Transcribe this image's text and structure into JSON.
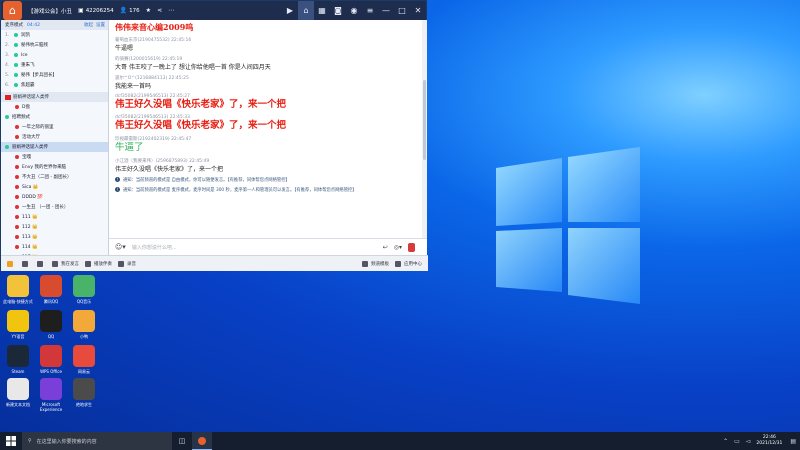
{
  "window": {
    "title": "【游戏公会】小丑",
    "id_count": "42206254",
    "user_count": "176",
    "star": "★"
  },
  "left_panel": {
    "mode_label": "麦序模式",
    "mode_time": "04:42",
    "mode_actions": [
      "收起",
      "设置"
    ],
    "queue": [
      {
        "num": "1.",
        "name": "润凯"
      },
      {
        "num": "2.",
        "name": "秘伟杭三脑残"
      },
      {
        "num": "3.",
        "name": "Ice"
      },
      {
        "num": "4.",
        "name": "重朱飞"
      },
      {
        "num": "5.",
        "name": "秘伟【步兵团长】"
      },
      {
        "num": "6.",
        "name": "焦超霸"
      }
    ],
    "channel_header": "丽娟神话诞人类传",
    "items": [
      {
        "label": "D盘",
        "indent": 1,
        "selected": false
      },
      {
        "label": "招聘频式",
        "indent": 0,
        "selected": false
      },
      {
        "label": "一年之际的丽里",
        "indent": 1,
        "selected": false
      },
      {
        "label": "活动大厅",
        "indent": 1,
        "selected": false
      },
      {
        "label": "丽娟神话诞人类传",
        "indent": 0,
        "selected": true
      },
      {
        "label": "宝嘎",
        "indent": 1,
        "selected": false
      },
      {
        "label": "Envy 我的世界你来脑",
        "indent": 1,
        "selected": false
      },
      {
        "label": "不大丑（二团 - 副团长）",
        "indent": 1,
        "selected": false
      },
      {
        "label": "Sica 👑",
        "indent": 1,
        "selected": false
      },
      {
        "label": "DDDD 💯",
        "indent": 1,
        "selected": false
      },
      {
        "label": "一生丑 （一团 - 团长）",
        "indent": 1,
        "selected": false
      },
      {
        "label": "111 👑",
        "indent": 1,
        "selected": false
      },
      {
        "label": "112 👑",
        "indent": 1,
        "selected": false
      },
      {
        "label": "113 👑",
        "indent": 1,
        "selected": false
      },
      {
        "label": "114 👑",
        "indent": 1,
        "selected": false
      },
      {
        "label": "117 👑",
        "indent": 1,
        "selected": false
      }
    ]
  },
  "chat": {
    "messages": [
      {
        "meta": "",
        "body": "伟伟来音心编2009呜",
        "style": "serifred"
      },
      {
        "meta": "葡萄血东京(2190475532)  22:45:16",
        "body": "牛逼嗯",
        "style": "normal"
      },
      {
        "meta": "的骑赛(1200015619)  22:45:19",
        "body": "大哥  伟王咬了一晚上了  想让你给他唱一首  你是人间四月天",
        "style": "normal"
      },
      {
        "meta": "遥尔^O^(1216884113)  22:45:25",
        "body": "我能来一首吗",
        "style": "normal"
      },
      {
        "meta": "dcf35082(2199546513)  22:45:27",
        "body": "伟王好久没唱《快乐老家》了，来一个把",
        "style": "big"
      },
      {
        "meta": "dcf35082(2199546513)  22:45:33",
        "body": "伟王好久没唱《快乐老家》了，来一个把",
        "style": "big"
      },
      {
        "meta": "珍视最雷斯(2192402319)  22:45:47",
        "body": "牛逼了",
        "style": "green"
      },
      {
        "meta": "小江酒（我要来伟）(2596875893)  22:45:49",
        "body": "伟王好久没唱《快乐老家》了，来一个把",
        "style": "normal"
      }
    ],
    "notices": [
      "通知：当前频道的模式是 自由模式，你可以随便发言。【有推荐，同体帮您点网络管控】",
      "通知：当前频道的模式是 麦序模式，麦序时间是 300 秒，麦序第一人和管理员可以发言。【有推荐，同体帮您点网络管控】"
    ]
  },
  "input": {
    "placeholder": "输入你想说什么吧..."
  },
  "bottom_bar": {
    "items": [
      "",
      "",
      "",
      "我在发言",
      "播放伴奏",
      "录音"
    ],
    "right_items": [
      "频道模板",
      "应用中心"
    ]
  },
  "desktop_icons": [
    {
      "label": "此电脑-快捷方式",
      "color": "#f2c23a"
    },
    {
      "label": "腾讯QQ",
      "color": "#d94b2e"
    },
    {
      "label": "QQ音乐",
      "color": "#49b36a"
    },
    {
      "label": "YY语音",
      "color": "#f1c40f"
    },
    {
      "label": "QQ",
      "color": "#1e1e1e"
    },
    {
      "label": "小鸭",
      "color": "#f3a83a"
    },
    {
      "label": "Steam",
      "color": "#1b2838"
    },
    {
      "label": "WPS Office",
      "color": "#d2383a"
    },
    {
      "label": "网易云",
      "color": "#e84b3c"
    },
    {
      "label": "新建文本文档",
      "color": "#e8e8e8"
    },
    {
      "label": "Microsoft Experience",
      "color": "#7a3fd8"
    },
    {
      "label": "绝地求生",
      "color": "#4b4b4b"
    }
  ],
  "taskbar": {
    "search_placeholder": "在这里输入你要搜索的内容",
    "time": "22:46",
    "date": "2021/12/31"
  }
}
